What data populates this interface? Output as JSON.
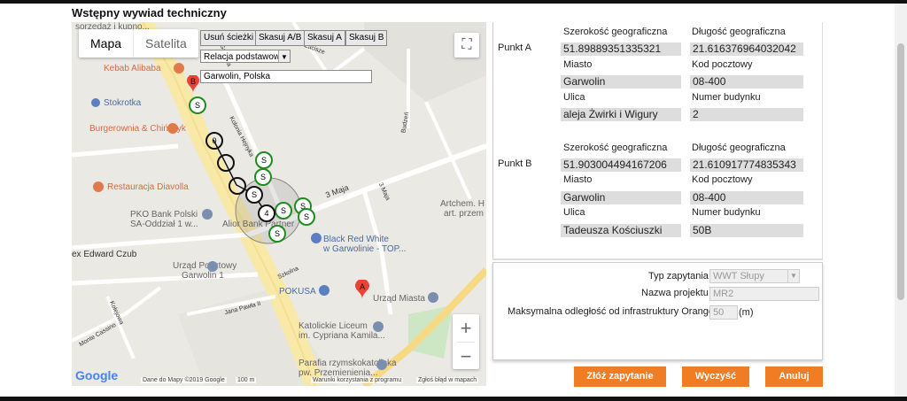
{
  "title": "Wstępny wywiad techniczny",
  "map": {
    "map_type": {
      "map": "Mapa",
      "satellite": "Satelita"
    },
    "tools": {
      "clear_path": "Usuń ścieżki",
      "clear_ab": "Skasuj A/B",
      "clear_a": "Skasuj A",
      "clear_b": "Skasuj B"
    },
    "relation_select": "Relacja podstawowa",
    "search_value": "Garwolin, Polska",
    "zoom_in": "+",
    "zoom_out": "−",
    "google_logo": "Google",
    "attribution": "Dane do Mapy ©2019 Google",
    "scale": "100 m",
    "terms": "Warunki korzystania z programu",
    "report": "Zgłoś błąd w mapach",
    "places": {
      "kebab": "Kebab Alibaba",
      "stokrotka": "Stokrotka",
      "burgerownia": "Burgerownia & Chińczyk",
      "diavolla": "Restauracja Diavolla",
      "pko": "PKO Bank Polski",
      "pko2": "SA-Oddział 1 w...",
      "alior": "Alior Bank Partner",
      "edward": "ex Edward Czub",
      "poczta": "Urząd Pocztowy",
      "poczta2": "Garwolin 1",
      "pokusa": "POKUSA",
      "urzad": "Urząd Miasta",
      "blackred": "Black Red White",
      "blackred2": "w Garwolinie - TOP...",
      "artchem": "Artchem. H",
      "artchem2": "art. przem",
      "liceum": "Katolickie Liceum",
      "liceum2": "im. Cypriana Kamila...",
      "parafia": "Parafia rzymskokatolicka",
      "parafia2": "pw. Przemienienia...",
      "top_cut": "sorzedaż i kupno...",
      "street_3maja": "3 Maja",
      "street_szkolna": "Szkolna",
      "street_jana_pawla": "Jana Pawła II",
      "street_monte": "Monte Cassino",
      "street_kolejowa": "Kolejowa",
      "street_budzeni": "Budzeń",
      "street_zacisze": "Zacisze",
      "street_3maja2": "3 Maja",
      "street_gabriela": "Gabriela",
      "street_kolonia": "Kolonia Hejnyka"
    },
    "markers": {
      "a": "A",
      "b": "B",
      "s": "S",
      "path_label": "4",
      "path_zero": "0"
    }
  },
  "point_a": {
    "label": "Punkt A",
    "lat_label": "Szerokość geograficzna",
    "lng_label": "Długość geograficzna",
    "lat": "51.89889351335321",
    "lng": "21.616376964032042",
    "city_label": "Miasto",
    "city": "Garwolin",
    "zip_label": "Kod pocztowy",
    "zip": "08-400",
    "street_label": "Ulica",
    "street": "aleja Żwirki i Wigury",
    "number_label": "Numer budynku",
    "number": "2"
  },
  "point_b": {
    "label": "Punkt B",
    "lat_label": "Szerokość geograficzna",
    "lng_label": "Długość geograficzna",
    "lat": "51.903004494167206",
    "lng": "21.610917774835343",
    "city_label": "Miasto",
    "city": "Garwolin",
    "zip_label": "Kod pocztowy",
    "zip": "08-400",
    "street_label": "Ulica",
    "street": "Tadeusza Kościuszki",
    "number_label": "Numer budynku",
    "number": "50B"
  },
  "query": {
    "type_label": "Typ zapytania",
    "type_value": "WWT Słupy",
    "project_label": "Nazwa projektu",
    "project_value": "MR2",
    "distance_label": "Maksymalna odległość od infrastruktury Orange",
    "distance_value": "50",
    "distance_unit": "(m)"
  },
  "buttons": {
    "submit": "Złóż zapytanie",
    "clear": "Wyczyść",
    "cancel": "Anuluj"
  },
  "colors": {
    "accent": "#f07c24",
    "marker_red": "#ea4335",
    "marker_green": "#1e8c1e"
  }
}
